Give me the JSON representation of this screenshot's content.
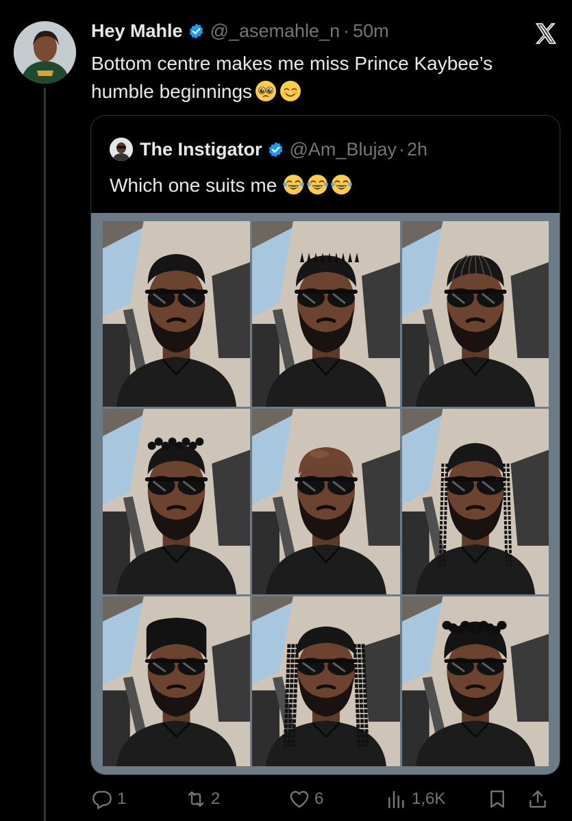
{
  "post": {
    "author_name": "Hey Mahle",
    "handle": "@_asemahle_n",
    "separator": "·",
    "time": "50m",
    "text": "Bottom centre makes me miss Prince Kaybee’s humble beginnings",
    "emojis": [
      "pleading-face",
      "smiling-face"
    ]
  },
  "quote": {
    "author_name": "The Instigator",
    "handle": "@Am_Blujay",
    "separator": "·",
    "time": "2h",
    "text": "Which one suits me",
    "emojis": [
      "tears-of-joy",
      "tears-of-joy",
      "tears-of-joy"
    ],
    "grid_images": [
      "short-top-fade",
      "short-twists",
      "cornrows",
      "curly-twist-top",
      "bald",
      "long-braids",
      "flat-top-afro",
      "long-locs",
      "curly-afro"
    ]
  },
  "actions": {
    "replies": "1",
    "reposts": "2",
    "likes": "6",
    "views": "1,6K"
  },
  "colors": {
    "background": "#000000",
    "text_primary": "#e7e9ea",
    "text_secondary": "#71767b",
    "verified": "#1d9bf0",
    "border": "#2f3336"
  }
}
